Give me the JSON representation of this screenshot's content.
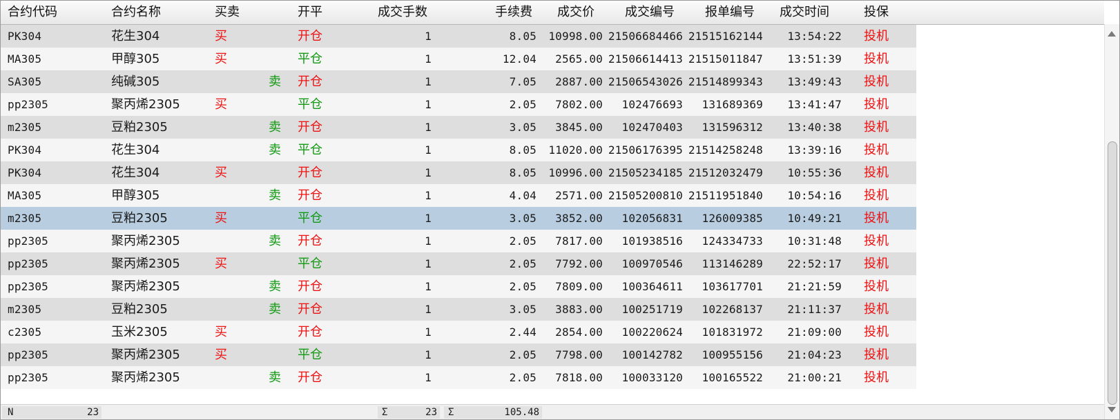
{
  "columns": {
    "code": "合约代码",
    "name": "合约名称",
    "buysell": "买卖",
    "openclose": "开平",
    "qty": "成交手数",
    "fee": "手续费",
    "price": "成交价",
    "trade_no": "成交编号",
    "order_no": "报单编号",
    "time": "成交时间",
    "hedge": "投保"
  },
  "rows": [
    {
      "code": "PK304",
      "name": "花生304",
      "side": "买",
      "oc": "开仓",
      "qty": "1",
      "fee": "8.05",
      "price": "10998.00",
      "trade_no": "21506684466",
      "order_no": "21515162144",
      "time": "13:54:22",
      "hedge": "投机"
    },
    {
      "code": "MA305",
      "name": "甲醇305",
      "side": "买",
      "oc": "平仓",
      "qty": "1",
      "fee": "12.04",
      "price": "2565.00",
      "trade_no": "21506614413",
      "order_no": "21515011847",
      "time": "13:51:39",
      "hedge": "投机"
    },
    {
      "code": "SA305",
      "name": "纯碱305",
      "side": "卖",
      "oc": "开仓",
      "qty": "1",
      "fee": "7.05",
      "price": "2887.00",
      "trade_no": "21506543026",
      "order_no": "21514899343",
      "time": "13:49:43",
      "hedge": "投机"
    },
    {
      "code": "pp2305",
      "name": "聚丙烯2305",
      "side": "买",
      "oc": "平仓",
      "qty": "1",
      "fee": "2.05",
      "price": "7802.00",
      "trade_no": "102476693",
      "order_no": "131689369",
      "time": "13:41:47",
      "hedge": "投机"
    },
    {
      "code": "m2305",
      "name": "豆粕2305",
      "side": "卖",
      "oc": "开仓",
      "qty": "1",
      "fee": "3.05",
      "price": "3845.00",
      "trade_no": "102470403",
      "order_no": "131596312",
      "time": "13:40:38",
      "hedge": "投机"
    },
    {
      "code": "PK304",
      "name": "花生304",
      "side": "卖",
      "oc": "平仓",
      "qty": "1",
      "fee": "8.05",
      "price": "11020.00",
      "trade_no": "21506176395",
      "order_no": "21514258248",
      "time": "13:39:16",
      "hedge": "投机"
    },
    {
      "code": "PK304",
      "name": "花生304",
      "side": "买",
      "oc": "开仓",
      "qty": "1",
      "fee": "8.05",
      "price": "10996.00",
      "trade_no": "21505234185",
      "order_no": "21512032479",
      "time": "10:55:36",
      "hedge": "投机"
    },
    {
      "code": "MA305",
      "name": "甲醇305",
      "side": "卖",
      "oc": "开仓",
      "qty": "1",
      "fee": "4.04",
      "price": "2571.00",
      "trade_no": "21505200810",
      "order_no": "21511951840",
      "time": "10:54:16",
      "hedge": "投机"
    },
    {
      "code": "m2305",
      "name": "豆粕2305",
      "side": "买",
      "oc": "平仓",
      "qty": "1",
      "fee": "3.05",
      "price": "3852.00",
      "trade_no": "102056831",
      "order_no": "126009385",
      "time": "10:49:21",
      "hedge": "投机",
      "selected": true
    },
    {
      "code": "pp2305",
      "name": "聚丙烯2305",
      "side": "卖",
      "oc": "开仓",
      "qty": "1",
      "fee": "2.05",
      "price": "7817.00",
      "trade_no": "101938516",
      "order_no": "124334733",
      "time": "10:31:48",
      "hedge": "投机"
    },
    {
      "code": "pp2305",
      "name": "聚丙烯2305",
      "side": "买",
      "oc": "平仓",
      "qty": "1",
      "fee": "2.05",
      "price": "7792.00",
      "trade_no": "100970546",
      "order_no": "113146289",
      "time": "22:52:17",
      "hedge": "投机"
    },
    {
      "code": "pp2305",
      "name": "聚丙烯2305",
      "side": "卖",
      "oc": "开仓",
      "qty": "1",
      "fee": "2.05",
      "price": "7809.00",
      "trade_no": "100364611",
      "order_no": "103617701",
      "time": "21:21:59",
      "hedge": "投机"
    },
    {
      "code": "m2305",
      "name": "豆粕2305",
      "side": "卖",
      "oc": "开仓",
      "qty": "1",
      "fee": "3.05",
      "price": "3883.00",
      "trade_no": "100251719",
      "order_no": "102268137",
      "time": "21:11:37",
      "hedge": "投机"
    },
    {
      "code": "c2305",
      "name": "玉米2305",
      "side": "买",
      "oc": "开仓",
      "qty": "1",
      "fee": "2.44",
      "price": "2854.00",
      "trade_no": "100220624",
      "order_no": "101831972",
      "time": "21:09:00",
      "hedge": "投机"
    },
    {
      "code": "pp2305",
      "name": "聚丙烯2305",
      "side": "买",
      "oc": "平仓",
      "qty": "1",
      "fee": "2.05",
      "price": "7798.00",
      "trade_no": "100142782",
      "order_no": "100955156",
      "time": "21:04:23",
      "hedge": "投机"
    },
    {
      "code": "pp2305",
      "name": "聚丙烯2305",
      "side": "卖",
      "oc": "开仓",
      "qty": "1",
      "fee": "2.05",
      "price": "7818.00",
      "trade_no": "100033120",
      "order_no": "100165522",
      "time": "21:00:21",
      "hedge": "投机"
    }
  ],
  "footer": {
    "count_label": "N",
    "count_value": "23",
    "qty_sum_label": "Σ",
    "qty_sum_value": "23",
    "fee_sum_label": "Σ",
    "fee_sum_value": "105.48"
  },
  "colors": {
    "buy": "#ee1111",
    "sell": "#119911",
    "open": "#ee1111",
    "close": "#119911",
    "hedge": "#ee1111",
    "row_even": "#dedede",
    "row_odd": "#f5f5f5",
    "row_selected": "#b8cde0"
  },
  "icons": {
    "scroll_up": "triangle-up-icon",
    "scroll_down": "triangle-down-icon"
  }
}
